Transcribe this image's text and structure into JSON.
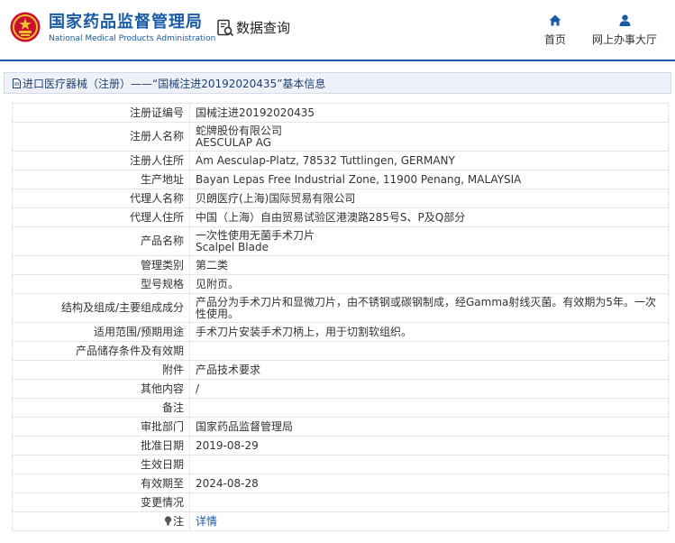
{
  "header": {
    "brand_cn": "国家药品监督管理局",
    "brand_en": "National Medical Products Administration",
    "data_query_label": "数据查询",
    "nav_home": "首页",
    "nav_online_hall": "网上办事大厅",
    "brand_color": "#1a5ba6"
  },
  "titlebar": {
    "text": "进口医疗器械（注册）——“国械注进20192020435”基本信息"
  },
  "fields": [
    {
      "label": "注册证编号",
      "value": "国械注进20192020435"
    },
    {
      "label": "注册人名称",
      "value_lines": [
        "蛇牌股份有限公司",
        "AESCULAP AG"
      ]
    },
    {
      "label": "注册人住所",
      "value": "Am Aesculap-Platz, 78532 Tuttlingen, GERMANY"
    },
    {
      "label": "生产地址",
      "value": "Bayan Lepas Free Industrial Zone, 11900 Penang, MALAYSIA"
    },
    {
      "label": "代理人名称",
      "value": "贝朗医疗(上海)国际贸易有限公司"
    },
    {
      "label": "代理人住所",
      "value": "中国（上海）自由贸易试验区港澳路285号S、P及Q部分"
    },
    {
      "label": "产品名称",
      "value_lines": [
        "一次性使用无菌手术刀片",
        "Scalpel Blade"
      ]
    },
    {
      "label": "管理类别",
      "value": "第二类"
    },
    {
      "label": "型号规格",
      "value": "见附页。"
    },
    {
      "label": "结构及组成/主要组成成分",
      "value": "产品分为手术刀片和显微刀片，由不锈钢或碳钢制成，经Gamma射线灭菌。有效期为5年。一次性使用。"
    },
    {
      "label": "适用范围/预期用途",
      "value": "手术刀片安装手术刀柄上，用于切割软组织。"
    },
    {
      "label": "产品储存条件及有效期",
      "value": ""
    },
    {
      "label": "附件",
      "value": "产品技术要求"
    },
    {
      "label": "其他内容",
      "value": "/"
    },
    {
      "label": "备注",
      "value": ""
    },
    {
      "label": "审批部门",
      "value": "国家药品监督管理局"
    },
    {
      "label": "批准日期",
      "value": "2019-08-29"
    },
    {
      "label": "生效日期",
      "value": ""
    },
    {
      "label": "有效期至",
      "value": "2024-08-28"
    },
    {
      "label": "变更情况",
      "value": ""
    },
    {
      "label": "注",
      "value": "详情",
      "icon": "lightbulb-icon"
    }
  ]
}
